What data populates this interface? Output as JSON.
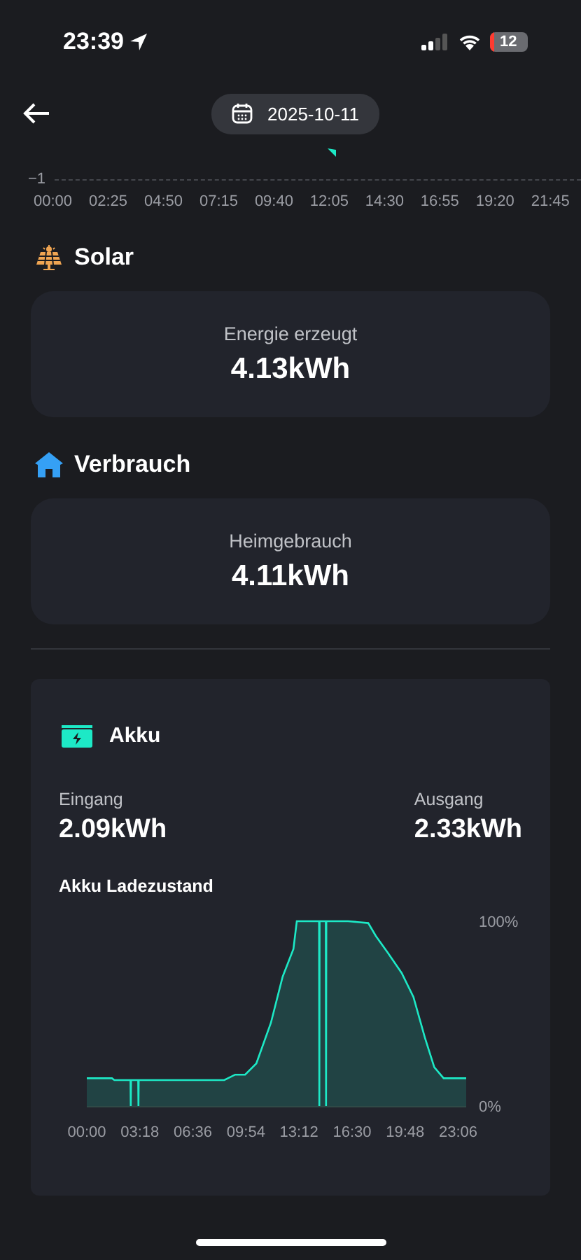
{
  "status_bar": {
    "time": "23:39",
    "battery": "12"
  },
  "header": {
    "date": "2025-10-11"
  },
  "top_chart": {
    "y_tick": "−1",
    "x_labels": [
      "00:00",
      "02:25",
      "04:50",
      "07:15",
      "09:40",
      "12:05",
      "14:30",
      "16:55",
      "19:20",
      "21:45"
    ]
  },
  "sections": [
    {
      "kind": "solar",
      "title": "Solar",
      "label": "Energie erzeugt",
      "value": "4.13kWh"
    },
    {
      "kind": "home",
      "title": "Verbrauch",
      "label": "Heimgebrauch",
      "value": "4.11kWh"
    }
  ],
  "battery": {
    "title": "Akku",
    "stats": [
      {
        "label": "Eingang",
        "value": "2.09kWh"
      },
      {
        "label": "Ausgang",
        "value": "2.33kWh"
      }
    ],
    "chart_title": "Akku Ladezustand",
    "chart_data": {
      "type": "area",
      "xlim": [
        0,
        1416
      ],
      "ylim": [
        0,
        100
      ],
      "x": [
        0,
        94,
        103,
        163,
        164,
        165,
        192,
        193,
        194,
        513,
        554,
        591,
        633,
        687,
        731,
        771,
        784,
        867,
        868,
        869,
        892,
        893,
        894,
        975,
        1050,
        1079,
        1123,
        1175,
        1219,
        1262,
        1297,
        1332,
        1416
      ],
      "series": [
        {
          "color": "#1de9c6",
          "values": [
            15,
            15,
            14,
            14,
            0,
            14,
            14,
            0,
            14,
            14,
            17,
            17,
            23,
            45,
            70,
            85,
            100,
            100,
            0,
            100,
            100,
            0,
            100,
            100,
            99,
            92,
            83,
            72,
            59,
            37,
            21,
            15,
            15
          ]
        }
      ],
      "xticks": [
        {
          "value": 0,
          "label": "00:00"
        },
        {
          "value": 198,
          "label": "03:18"
        },
        {
          "value": 396,
          "label": "06:36"
        },
        {
          "value": 594,
          "label": "09:54"
        },
        {
          "value": 792,
          "label": "13:12"
        },
        {
          "value": 990,
          "label": "16:30"
        },
        {
          "value": 1188,
          "label": "19:48"
        },
        {
          "value": 1386,
          "label": "23:06"
        }
      ],
      "yticks": [
        {
          "value": 0,
          "label": "0%"
        },
        {
          "value": 100,
          "label": "100%"
        }
      ]
    }
  }
}
